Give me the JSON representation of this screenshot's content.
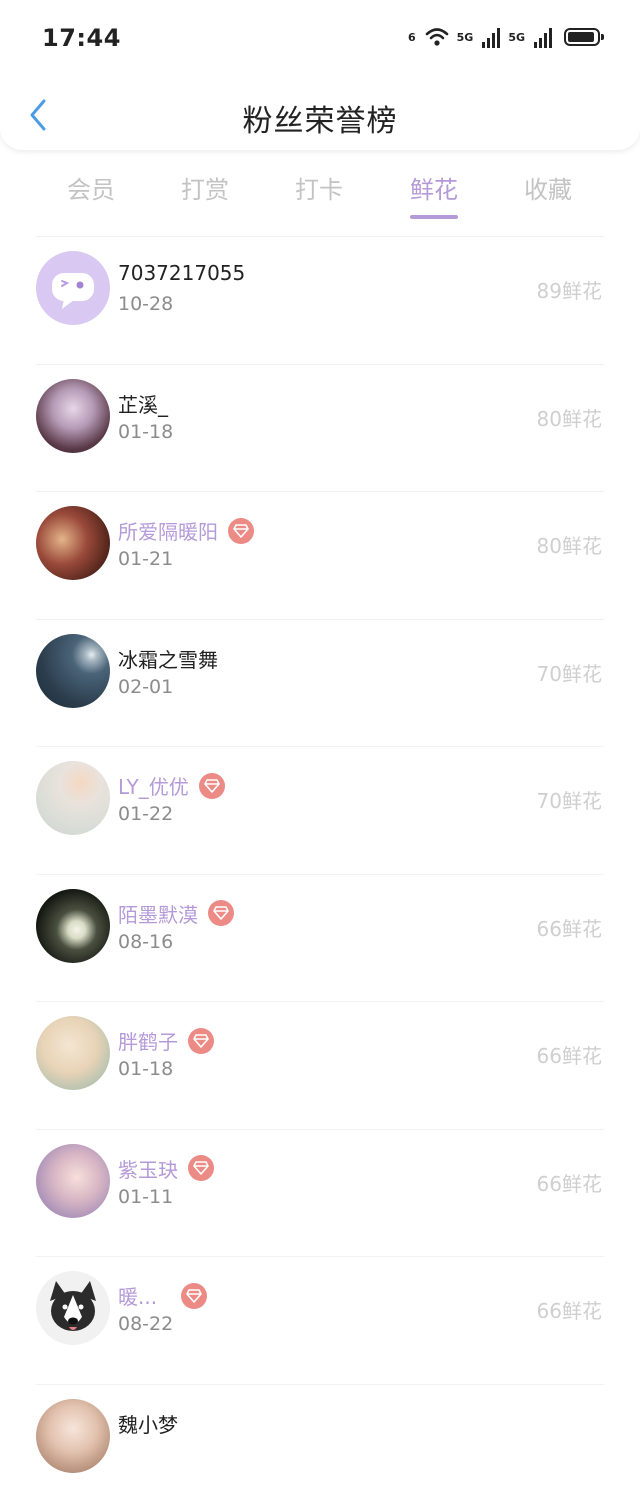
{
  "status_bar": {
    "time": "17:44",
    "wifi_label": "6",
    "signal1_label": "5G",
    "signal2_label": "5G"
  },
  "nav": {
    "title": "粉丝荣誉榜",
    "back_icon": "chevron-left-icon"
  },
  "tabs": [
    {
      "label": "会员",
      "active": false
    },
    {
      "label": "打赏",
      "active": false
    },
    {
      "label": "打卡",
      "active": false
    },
    {
      "label": "鲜花",
      "active": true
    },
    {
      "label": "收藏",
      "active": false
    }
  ],
  "colors": {
    "accent": "#b59ad8",
    "gem": "#ec8a86",
    "score": "#cfcfcf"
  },
  "fans": [
    {
      "name": "7037217055",
      "date": "10-28",
      "score": "89鲜花",
      "vip": false,
      "avatar": "default-chat-avatar"
    },
    {
      "name": "芷溪_",
      "date": "01-18",
      "score": "80鲜花",
      "vip": false,
      "avatar": "anime-girl-avatar"
    },
    {
      "name": "所爱隔暖阳",
      "date": "01-21",
      "score": "80鲜花",
      "vip": true,
      "avatar": "couple-photo-avatar"
    },
    {
      "name": "冰霜之雪舞",
      "date": "02-01",
      "score": "70鲜花",
      "vip": false,
      "avatar": "night-landscape-avatar"
    },
    {
      "name": "LY_优优",
      "date": "01-22",
      "score": "70鲜花",
      "vip": true,
      "avatar": "child-photo-avatar"
    },
    {
      "name": "陌墨默漠",
      "date": "08-16",
      "score": "66鲜花",
      "vip": true,
      "avatar": "white-flowers-avatar"
    },
    {
      "name": "胖鹤子",
      "date": "01-18",
      "score": "66鲜花",
      "vip": true,
      "avatar": "cartoon-pig-avatar"
    },
    {
      "name": "紫玉玦",
      "date": "01-11",
      "score": "66鲜花",
      "vip": true,
      "avatar": "girl-portrait-avatar"
    },
    {
      "name": "暖...",
      "date": "08-22",
      "score": "66鲜花",
      "vip": true,
      "avatar": "husky-dog-avatar"
    },
    {
      "name": "魏小梦",
      "date": "",
      "score": "",
      "vip": false,
      "avatar": "anime-portrait-avatar"
    }
  ]
}
